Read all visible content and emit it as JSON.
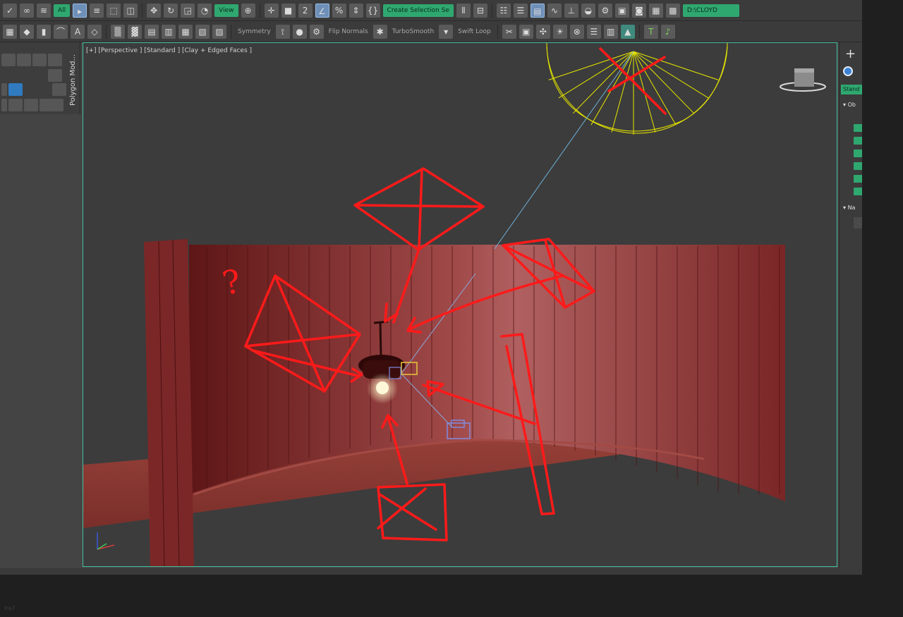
{
  "toolbar_top": {
    "selection_filter": "All",
    "view_dropdown": "View",
    "selection_set": "Create Selection Se",
    "project_path": "D:\\CLOYD",
    "percent_snap_label": "%"
  },
  "toolbar_ribbon": {
    "symmetry_label": "Symmetry",
    "flip_normals_label": "Flip Normals",
    "turbosmooth_label": "TurboSmooth",
    "swift_loop_label": "Swift Loop"
  },
  "left_panel": {
    "vertical_tab": "Polygon Mod..."
  },
  "viewport": {
    "label": "[+] [Perspective ] [Standard ] [Clay + Edged Faces ]",
    "annotation_question": "?"
  },
  "right_panel": {
    "create_tab": "+",
    "standard_dropdown": "Stand",
    "object_type_header": "Ob",
    "name_color_header": "Na"
  },
  "corner": {
    "text": "Ira7"
  },
  "colors": {
    "viewport_border": "#43c1a3",
    "accent_green": "#2fa870",
    "wall": "#8a2f2f",
    "annotation": "#ff1a1a",
    "spotlight": "#e6e600"
  }
}
